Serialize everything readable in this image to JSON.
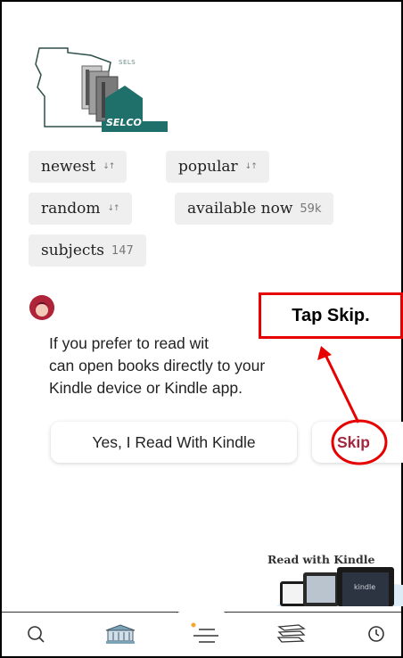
{
  "logo": {
    "org": "SELCO",
    "tag": "SELS",
    "icon": "selco-logo"
  },
  "filters": [
    {
      "label": "newest",
      "count": "",
      "sort_icon": "sort-arrows-icon"
    },
    {
      "label": "popular",
      "count": "",
      "sort_icon": "sort-arrows-icon"
    },
    {
      "label": "random",
      "count": "",
      "sort_icon": "sort-arrows-icon"
    },
    {
      "label": "available now",
      "count": "59k"
    },
    {
      "label": "subjects",
      "count": "147"
    }
  ],
  "kindle_prompt": {
    "avatar_icon": "libby-avatar-icon",
    "message_line1": "If you prefer to read wit",
    "message_line2": "can open books directly to your",
    "message_line3": "Kindle device or Kindle app.",
    "yes_button": "Yes, I Read With Kindle",
    "skip_button": "Skip"
  },
  "annotation": {
    "callout_text": "Tap Skip.",
    "color": "#e60000"
  },
  "promo": {
    "text": "Read with Kindle",
    "device_label": "kindle"
  },
  "nav": {
    "items": [
      {
        "name": "search",
        "icon": "search-icon"
      },
      {
        "name": "library",
        "icon": "library-building-icon"
      },
      {
        "name": "menu",
        "icon": "menu-icon"
      },
      {
        "name": "shelf",
        "icon": "books-stack-icon"
      },
      {
        "name": "timeline",
        "icon": "clock-icon"
      }
    ]
  },
  "colors": {
    "accent": "#a3283f",
    "chip_bg": "#efefef",
    "annotation": "#e60000"
  }
}
